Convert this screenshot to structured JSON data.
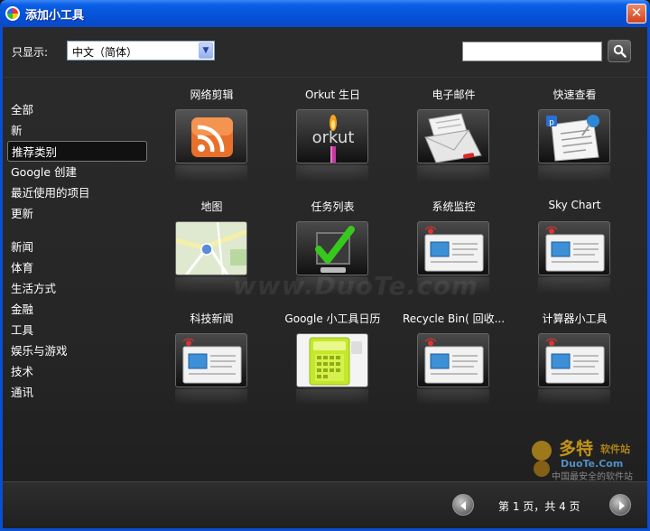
{
  "window": {
    "title": "添加小工具",
    "close_glyph": "✕"
  },
  "toolbar": {
    "filter_label": "只显示:",
    "language_select": {
      "value": "中文（简体）"
    },
    "search": {
      "value": ""
    }
  },
  "sidebar": {
    "group1": [
      "全部",
      "新",
      "推荐类别",
      "Google 创建",
      "最近使用的项目",
      "更新"
    ],
    "group2": [
      "新闻",
      "体育",
      "生活方式",
      "金融",
      "工具",
      "娱乐与游戏",
      "技术",
      "通讯"
    ],
    "selected": "推荐类别"
  },
  "gadgets": [
    {
      "label": "网络剪辑",
      "icon": "rss-feed-icon"
    },
    {
      "label": "Orkut 生日",
      "icon": "orkut-candle-icon"
    },
    {
      "label": "电子邮件",
      "icon": "envelope-icon"
    },
    {
      "label": "快速查看",
      "icon": "pushpin-note-icon"
    },
    {
      "label": "地图",
      "icon": "map-icon"
    },
    {
      "label": "任务列表",
      "icon": "checkmark-icon"
    },
    {
      "label": "系统监控",
      "icon": "generic-gadget-icon"
    },
    {
      "label": "Sky Chart",
      "icon": "generic-gadget-icon"
    },
    {
      "label": "科技新闻",
      "icon": "generic-gadget-icon"
    },
    {
      "label": "Google 小工具日历",
      "icon": "calendar-icon"
    },
    {
      "label": "Recycle Bin( 回收...",
      "icon": "generic-gadget-icon"
    },
    {
      "label": "计算器小工具",
      "icon": "generic-gadget-icon"
    }
  ],
  "watermark": {
    "text": "www.DuoTe.com"
  },
  "footer": {
    "page_text": "第 1 页，共 4 页"
  },
  "corner_logo": {
    "text_main": "多特",
    "text_sub": "软件站",
    "url": "DuoTe.Com",
    "slogan": "中国最安全的软件站"
  },
  "colors": {
    "titlebar": "#0551d8",
    "background": "#262626",
    "rss_orange": "#e8702a",
    "check_green": "#37c81d",
    "calendar_lime": "#c4e82a"
  }
}
